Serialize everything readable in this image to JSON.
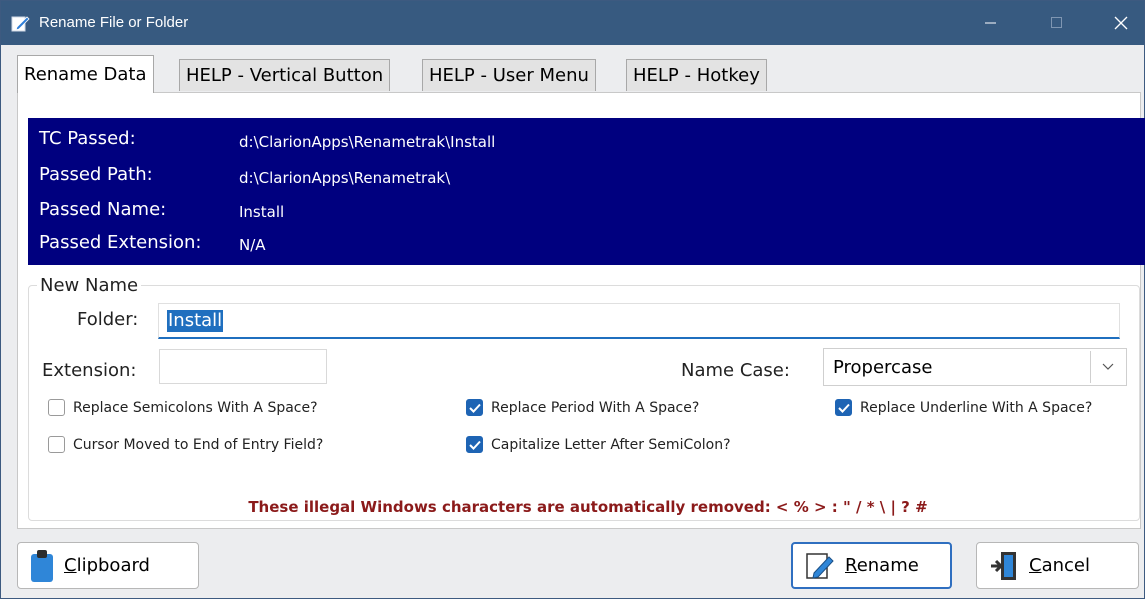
{
  "window": {
    "title": "Rename File or Folder"
  },
  "tabs": [
    {
      "label": "Rename Data"
    },
    {
      "label": "HELP - Vertical Button"
    },
    {
      "label": "HELP - User Menu"
    },
    {
      "label": "HELP - Hotkey"
    }
  ],
  "info": {
    "rows": [
      {
        "label": "TC Passed:",
        "value": "d:\\ClarionApps\\Renametrak\\Install"
      },
      {
        "label": "Passed Path:",
        "value": "d:\\ClarionApps\\Renametrak\\"
      },
      {
        "label": "Passed Name:",
        "value": "Install"
      },
      {
        "label": "Passed Extension:",
        "value": "N/A"
      }
    ]
  },
  "new_name": {
    "group_label": "New Name",
    "folder_label": "Folder:",
    "folder_value": "Install",
    "extension_label": "Extension:",
    "extension_value": "",
    "name_case_label": "Name Case:",
    "name_case_value": "Propercase"
  },
  "options": [
    {
      "label": "Replace Semicolons With A Space?",
      "checked": false
    },
    {
      "label": "Replace Period With A Space?",
      "checked": true
    },
    {
      "label": "Replace Underline With A Space?",
      "checked": true
    },
    {
      "label": "Cursor Moved to End of Entry Field?",
      "checked": false
    },
    {
      "label": "Capitalize Letter After SemiColon?",
      "checked": true
    }
  ],
  "notice": "These illegal Windows characters are automatically removed:  < % > : \" / * \\ | ? #",
  "buttons": {
    "clipboard": {
      "accel": "C",
      "rest": "lipboard"
    },
    "rename": {
      "accel": "R",
      "rest": "ename"
    },
    "cancel": {
      "accel": "C",
      "rest": "ancel"
    }
  },
  "colors": {
    "titlebar": "#375a80",
    "info_bg": "#00007f",
    "accent": "#1e64b4",
    "notice": "#8b1a1a"
  }
}
